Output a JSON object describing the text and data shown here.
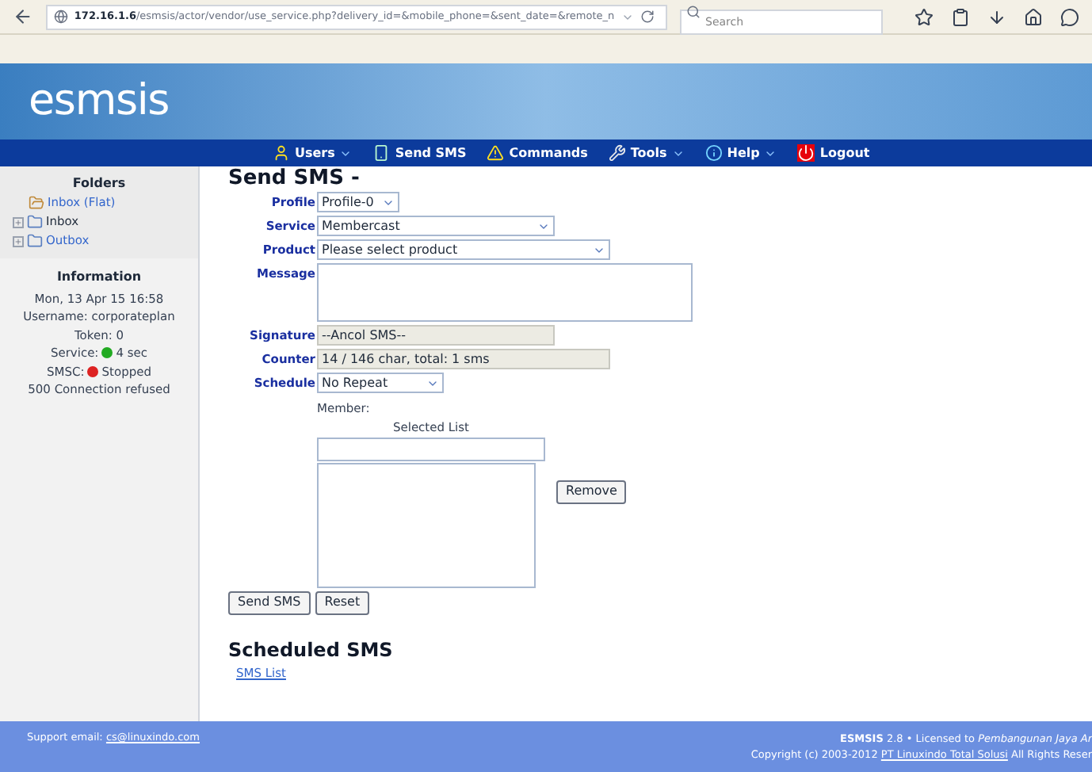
{
  "browser": {
    "url_host": "172.16.1.6",
    "url_path": "/esmsis/actor/vendor/use_service.php?delivery_id=&mobile_phone=&sent_date=&remote_n",
    "search": {
      "placeholder": "Search"
    }
  },
  "header": {
    "logo": "esmsis"
  },
  "nav": [
    {
      "label": "Users",
      "dropdown": true
    },
    {
      "label": "Send SMS",
      "dropdown": false
    },
    {
      "label": "Commands",
      "dropdown": false
    },
    {
      "label": "Tools",
      "dropdown": true
    },
    {
      "label": "Help",
      "dropdown": true
    },
    {
      "label": "Logout",
      "dropdown": false
    }
  ],
  "sidebar": {
    "folders_title": "Folders",
    "folders": [
      {
        "label": "Inbox (Flat)",
        "expandable": false,
        "link": true
      },
      {
        "label": "Inbox",
        "expandable": true,
        "link": false
      },
      {
        "label": "Outbox",
        "expandable": true,
        "link": true
      }
    ],
    "info_title": "Information",
    "info": [
      {
        "text": "Mon, 13 Apr 15 16:58"
      },
      {
        "text": "Username: corporateplan"
      },
      {
        "text": "Token: 0"
      },
      {
        "label": "Service:",
        "status": "4 sec",
        "color": "#22aa22"
      },
      {
        "label": "SMSC:",
        "status": "Stopped",
        "color": "#dd2222"
      },
      {
        "text": "500 Connection refused"
      }
    ]
  },
  "form": {
    "title": "Send SMS -",
    "fields": [
      {
        "label": "Profile",
        "kind": "select",
        "value": "Profile-0"
      },
      {
        "label": "Service",
        "kind": "select",
        "value": "Membercast"
      },
      {
        "label": "Product",
        "kind": "select",
        "value": "Please select product"
      },
      {
        "label": "Message",
        "kind": "textarea"
      },
      {
        "label": "Signature",
        "kind": "readonly",
        "value": "--Ancol SMS--"
      },
      {
        "label": "Counter",
        "kind": "readonly",
        "value": "14 / 146 char, total: 1 sms"
      },
      {
        "label": "Schedule",
        "kind": "select",
        "value": "No Repeat"
      }
    ],
    "member_label": "Member:",
    "selected_list_label": "Selected List",
    "remove_button": "Remove",
    "buttons": [
      "Send SMS",
      "Reset"
    ]
  },
  "scheduled": {
    "title": "Scheduled SMS",
    "link": "SMS List"
  },
  "footer": {
    "support_label": "Support email:",
    "support_email": "cs@linuxindo.com",
    "license": "**ESMSIS** 2.8 • Licensed to *Pembangunan Jaya Ar*",
    "copyright_prefix": "Copyright (c) 2003-2012",
    "company": "PT Linuxindo Total Solusi",
    "copyright_suffix": "All Rights Reser"
  }
}
